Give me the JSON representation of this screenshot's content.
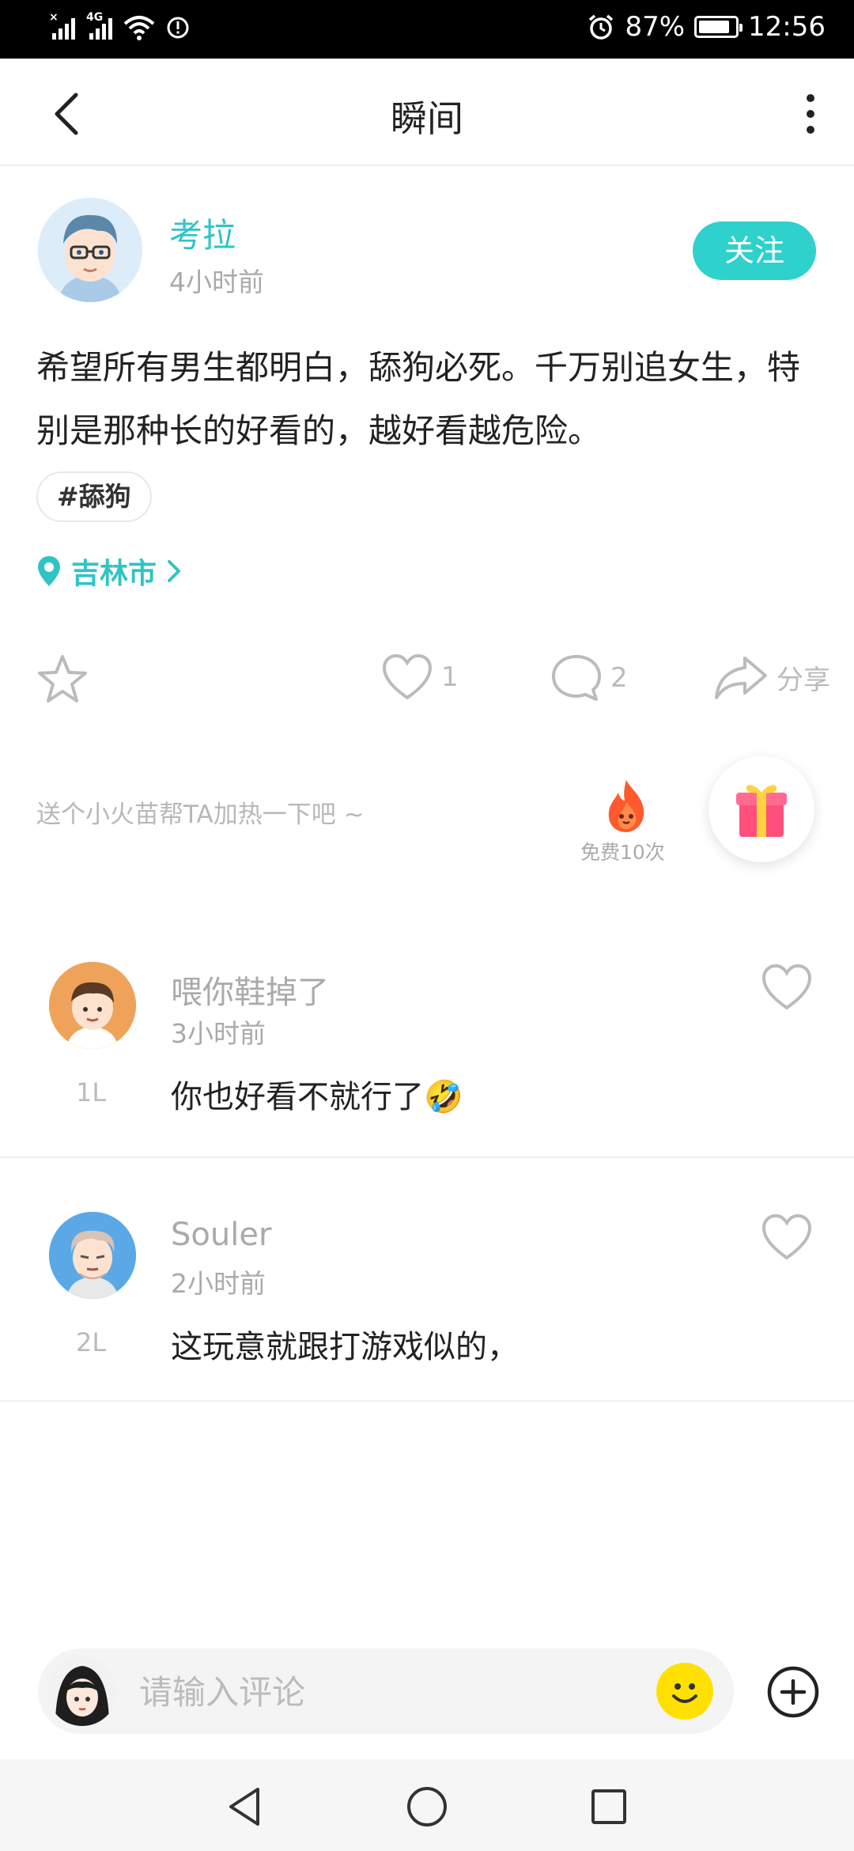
{
  "status_bar": {
    "battery": "87%",
    "battery_level": 0.87,
    "time": "12:56",
    "network": "4G"
  },
  "header": {
    "title": "瞬间"
  },
  "post": {
    "author": "考拉",
    "time": "4小时前",
    "follow_label": "关注",
    "text": "希望所有男生都明白，舔狗必死。千万别追女生，特别是那种长的好看的，越好看越危险。",
    "tag": "#舔狗",
    "location": "吉林市",
    "like_count": "1",
    "comment_count": "2",
    "share_label": "分享"
  },
  "heat": {
    "prompt": "送个小火苗帮TA加热一下吧 ~",
    "free_label": "免费10次"
  },
  "comments": [
    {
      "name": "喂你鞋掉了",
      "time": "3小时前",
      "floor": "1L",
      "text": "你也好看不就行了🤣"
    },
    {
      "name": "Souler",
      "time": "2小时前",
      "floor": "2L",
      "text": "这玩意就跟打游戏似的，"
    }
  ],
  "input": {
    "placeholder": "请输入评论"
  },
  "colors": {
    "accent": "#2ed1cc",
    "brand_text": "#2fc4c4"
  }
}
